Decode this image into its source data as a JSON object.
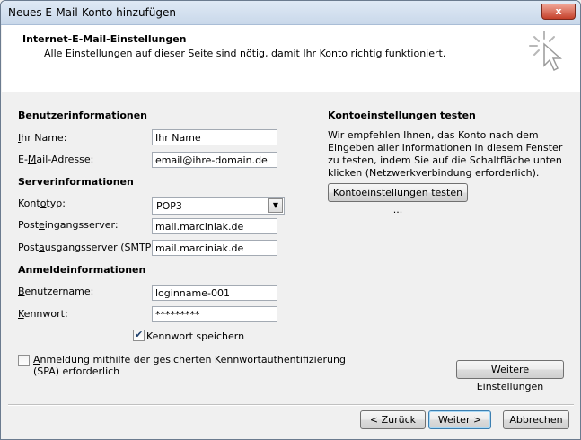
{
  "window": {
    "title": "Neues E-Mail-Konto hinzufügen",
    "close_label": "x"
  },
  "header": {
    "title": "Internet-E-Mail-Einstellungen",
    "subtitle": "Alle Einstellungen auf dieser Seite sind nötig, damit Ihr Konto richtig funktioniert."
  },
  "user_info": {
    "section_title": "Benutzerinformationen",
    "name_label_ul": "I",
    "name_label_rest": "hr Name:",
    "name_value": "Ihr Name",
    "email_label_pre": "E-",
    "email_label_ul": "M",
    "email_label_rest": "ail-Adresse:",
    "email_value": "email@ihre-domain.de"
  },
  "server_info": {
    "section_title": "Serverinformationen",
    "account_type_label_pre": "Kont",
    "account_type_label_ul": "o",
    "account_type_label_rest": "typ:",
    "account_type_value": "POP3",
    "incoming_label_pre": "Post",
    "incoming_label_ul": "e",
    "incoming_label_rest": "ingangsserver:",
    "incoming_value": "mail.marciniak.de",
    "outgoing_label_pre": "Post",
    "outgoing_label_ul": "a",
    "outgoing_label_rest": "usgangsserver (SMTP):",
    "outgoing_value": "mail.marciniak.de"
  },
  "login_info": {
    "section_title": "Anmeldeinformationen",
    "username_label_ul": "B",
    "username_label_rest": "enutzername:",
    "username_value": "loginname-001",
    "password_label_ul": "K",
    "password_label_rest": "ennwort:",
    "password_value": "*********",
    "remember_label": "Kennwort speichern",
    "remember_checked": true,
    "spa_label_line1_ul": "A",
    "spa_label_line1_rest": "nmeldung mithilfe der gesicherten Kennwortauthentifizierung",
    "spa_label_line2": "(SPA) erforderlich",
    "spa_checked": false
  },
  "test": {
    "section_title": "Kontoeinstellungen testen",
    "description": "Wir empfehlen Ihnen, das Konto nach dem Eingeben aller Informationen in diesem Fenster zu testen, indem Sie auf die Schaltfläche unten klicken (Netzwerkverbindung erforderlich).",
    "button_label": "Kontoeinstellungen testen ..."
  },
  "more_settings_label": "Weitere Einstellungen",
  "footer": {
    "back_label": "< Zurück",
    "next_label": "Weiter >",
    "cancel_label": "Abbrechen"
  },
  "colors": {
    "title_bar": "#dfe9f5",
    "close_button": "#c4402a",
    "default_button_border": "#3c7fb1"
  },
  "icons": [
    "close-icon",
    "wizard-cursor-icon",
    "dropdown-arrow-icon",
    "checkmark-icon"
  ]
}
